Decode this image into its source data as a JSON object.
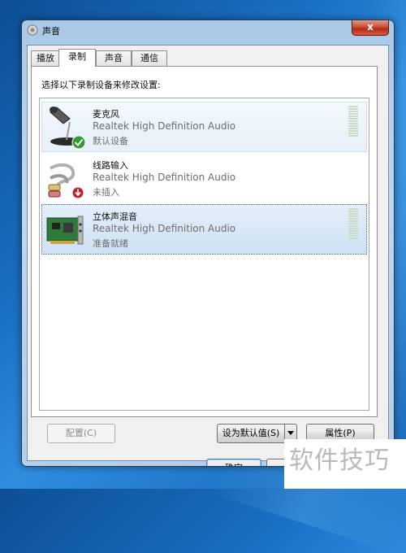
{
  "window": {
    "title": "声音",
    "close_label": "x"
  },
  "tabs": [
    {
      "label": "播放",
      "active": false
    },
    {
      "label": "录制",
      "active": true
    },
    {
      "label": "声音",
      "active": false
    },
    {
      "label": "通信",
      "active": false
    }
  ],
  "instruction": "选择以下录制设备来修改设置:",
  "devices": [
    {
      "name": "麦克风",
      "driver": "Realtek High Definition Audio",
      "status": "默认设备",
      "icon": "microphone-icon",
      "badge": "default-check-icon",
      "selected": false
    },
    {
      "name": "线路输入",
      "driver": "Realtek High Definition Audio",
      "status": "未插入",
      "icon": "line-in-cable-icon",
      "badge": "unplugged-arrow-icon",
      "selected": false
    },
    {
      "name": "立体声混音",
      "driver": "Realtek High Definition Audio",
      "status": "准备就绪",
      "icon": "sound-card-icon",
      "badge": "",
      "selected": true
    }
  ],
  "buttons": {
    "configure": "配置(C)",
    "set_default": "设为默认值(S)",
    "properties": "属性(P)",
    "ok": "确定",
    "partial": "I"
  },
  "watermark": "软件技巧",
  "colors": {
    "desktop": "#1a6fc4",
    "close_button": "#c8452e",
    "selected_row": "#cfe1f4",
    "default_check": "#2f9a2f",
    "unplugged_badge": "#c42020"
  }
}
